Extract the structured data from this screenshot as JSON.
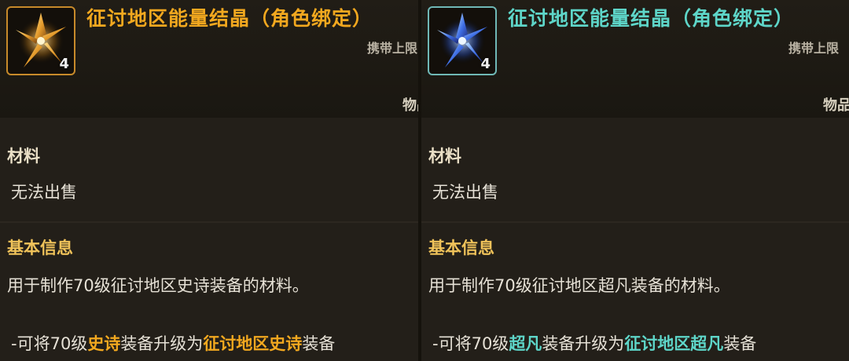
{
  "panels": [
    {
      "item_name": "征讨地区能量结晶（角色绑定）",
      "quantity": "4",
      "carry_label": "携带上限",
      "type_label": "物品",
      "section_material": "材料",
      "sell_text": "无法出售",
      "section_basic": "基本信息",
      "description": "用于制作70级征讨地区史诗装备的材料。",
      "upgrade": {
        "prefix": "-可将70级",
        "grade": "史诗",
        "middle": "装备升级为",
        "target": "征讨地区史诗",
        "suffix": "装备"
      },
      "crystal_icon": "gold-crystal-icon",
      "accent": "#f2a81f"
    },
    {
      "item_name": "征讨地区能量结晶（角色绑定）",
      "quantity": "4",
      "carry_label": "携带上限",
      "type_label": "物品",
      "section_material": "材料",
      "sell_text": "无法出售",
      "section_basic": "基本信息",
      "description": "用于制作70级征讨地区超凡装备的材料。",
      "upgrade": {
        "prefix": "-可将70级",
        "grade": "超凡",
        "middle": "装备升级为",
        "target": "征讨地区超凡",
        "suffix": "装备"
      },
      "crystal_icon": "blue-crystal-icon",
      "accent": "#5ed6c9"
    }
  ]
}
